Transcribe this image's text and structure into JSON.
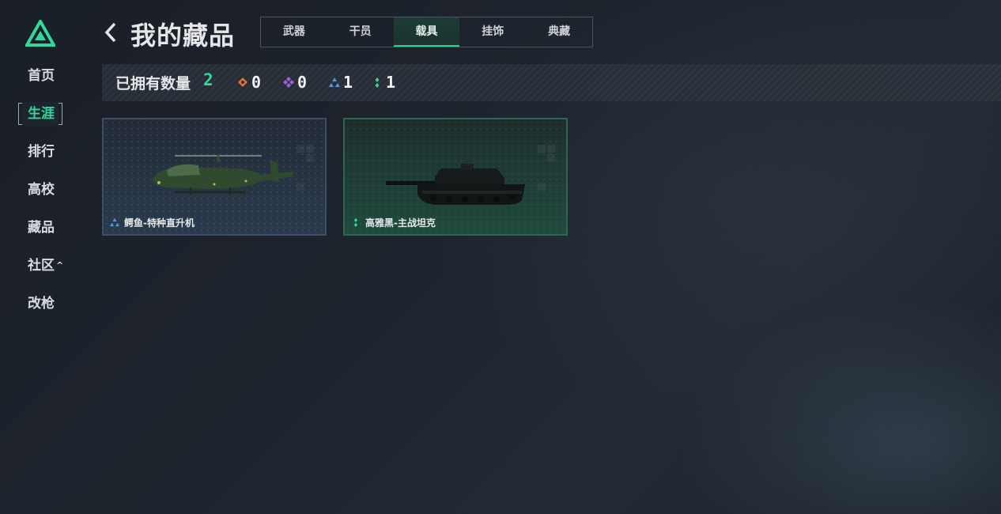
{
  "sidebar": {
    "items": [
      {
        "label": "首页"
      },
      {
        "label": "生涯"
      },
      {
        "label": "排行"
      },
      {
        "label": "高校"
      },
      {
        "label": "藏品"
      },
      {
        "label": "社区"
      },
      {
        "label": "改枪"
      }
    ],
    "community_chevron": "^"
  },
  "header": {
    "title": "我的藏品",
    "tabs": [
      {
        "label": "武器"
      },
      {
        "label": "干员"
      },
      {
        "label": "载具"
      },
      {
        "label": "挂饰"
      },
      {
        "label": "典藏"
      }
    ],
    "active_tab": "载具"
  },
  "owned": {
    "label": "已拥有数量",
    "total": "2",
    "rarities": [
      {
        "icon": "orange-diamond-icon",
        "color": "#d9773a",
        "count": "0"
      },
      {
        "icon": "purple-diamond-icon",
        "color": "#9a63e0",
        "count": "0"
      },
      {
        "icon": "blue-triangle-icon",
        "color": "#4d9be0",
        "count": "1"
      },
      {
        "icon": "green-dots-icon",
        "color": "#35d69a",
        "count": "1"
      }
    ]
  },
  "cards": [
    {
      "name": "鳄鱼-特种直升机",
      "rarity_icon": "blue-rarity-icon",
      "rarity_color": "#4d9be0",
      "image": "helicopter"
    },
    {
      "name": "高雅黑-主战坦克",
      "rarity_icon": "green-rarity-icon",
      "rarity_color": "#35d69a",
      "image": "tank"
    }
  ],
  "colors": {
    "accent": "#35d69a",
    "background": "#1e242d"
  }
}
